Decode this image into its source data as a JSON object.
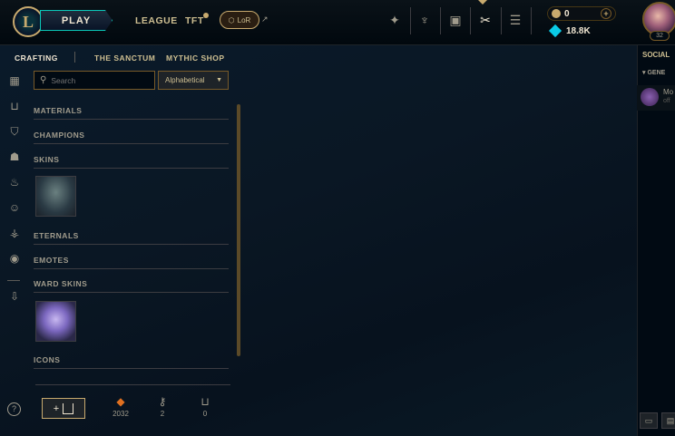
{
  "topbar": {
    "logo": "L",
    "play_label": "PLAY",
    "nav_league": "LEAGUE",
    "nav_tft": "TFT",
    "nav_lor": "LoR",
    "icons": [
      "clash-icon",
      "honor-icon",
      "collection-icon",
      "loot-icon",
      "store-icon"
    ],
    "rp": "0",
    "blue_essence": "18.8K",
    "level": "32"
  },
  "subnav": {
    "crafting": "CRAFTING",
    "sanctum": "THE SANCTUM",
    "mythic_shop": "MYTHIC SHOP"
  },
  "search": {
    "placeholder": "Search",
    "value": ""
  },
  "sort": {
    "selected": "Alphabetical"
  },
  "sections": {
    "materials": "MATERIALS",
    "champions": "CHAMPIONS",
    "skins": "SKINS",
    "eternals": "ETERNALS",
    "emotes": "EMOTES",
    "ward_skins": "WARD SKINS",
    "icons": "ICONS"
  },
  "bottom": {
    "help": "?",
    "add_chest": "+",
    "orange_essence": "2032",
    "keys": "2",
    "chests": "0"
  },
  "social": {
    "title": "SOCIAL",
    "group": "▾ GENE",
    "friend_name": "Mo",
    "friend_status": "off"
  },
  "colors": {
    "gold": "#c8aa6e",
    "teal": "#0ac8b9",
    "background": "#010a13",
    "essence_orange": "#e07020",
    "blue_essence": "#0acbe6"
  }
}
